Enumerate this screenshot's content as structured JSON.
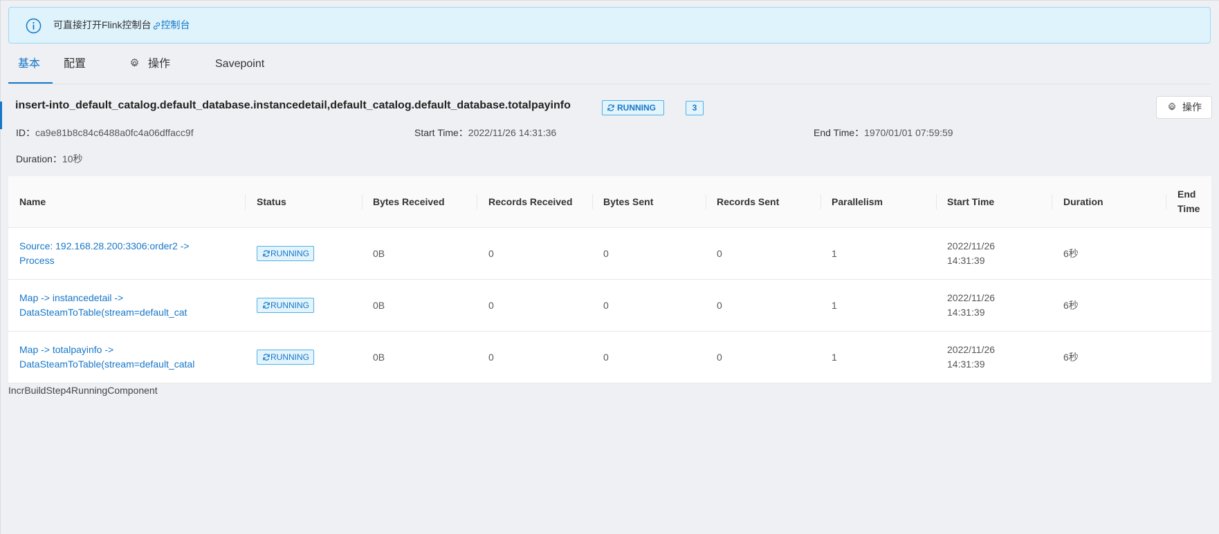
{
  "alert": {
    "text": "可直接打开Flink控制台",
    "link_label": "控制台"
  },
  "tabs": [
    {
      "label": "基本",
      "active": true
    },
    {
      "label": "配置",
      "active": false
    },
    {
      "label": "操作",
      "active": false,
      "icon": "gear-icon"
    },
    {
      "label": "Savepoint",
      "active": false
    }
  ],
  "job": {
    "name": "insert-into_default_catalog.default_database.instancedetail,default_catalog.default_database.totalpayinfo",
    "status": "RUNNING",
    "task_count": "3",
    "operate_label": "操作",
    "id_label": "ID：",
    "id": "ca9e81b8c84c6488a0fc4a06dffacc9f",
    "start_label": "Start Time：",
    "start_time": "2022/11/26 14:31:36",
    "end_label": "End Time：",
    "end_time": "1970/01/01 07:59:59",
    "duration_label": "Duration：",
    "duration": "10秒"
  },
  "table": {
    "columns": [
      "Name",
      "Status",
      "Bytes Received",
      "Records Received",
      "Bytes Sent",
      "Records Sent",
      "Parallelism",
      "Start Time",
      "Duration",
      "End Time"
    ],
    "rows": [
      {
        "name": "Source: 192.168.28.200:3306:order2 -> Process",
        "status": "RUNNING",
        "bytes_received": "0B",
        "records_received": "0",
        "bytes_sent": "0",
        "records_sent": "0",
        "parallelism": "1",
        "start_time": "2022/11/26 14:31:39",
        "duration": "6秒",
        "end_time": ""
      },
      {
        "name": "Map -> instancedetail -> DataSteamToTable(stream=default_cat",
        "status": "RUNNING",
        "bytes_received": "0B",
        "records_received": "0",
        "bytes_sent": "0",
        "records_sent": "0",
        "parallelism": "1",
        "start_time": "2022/11/26 14:31:39",
        "duration": "6秒",
        "end_time": ""
      },
      {
        "name": "Map -> totalpayinfo -> DataSteamToTable(stream=default_catal",
        "status": "RUNNING",
        "bytes_received": "0B",
        "records_received": "0",
        "bytes_sent": "0",
        "records_sent": "0",
        "parallelism": "1",
        "start_time": "2022/11/26 14:31:39",
        "duration": "6秒",
        "end_time": ""
      }
    ]
  },
  "footer": {
    "component_label": "IncrBuildStep4RunningComponent"
  },
  "colors": {
    "accent": "#1677c8",
    "alert_bg": "#def3fc",
    "page_bg": "#eef0f3"
  }
}
